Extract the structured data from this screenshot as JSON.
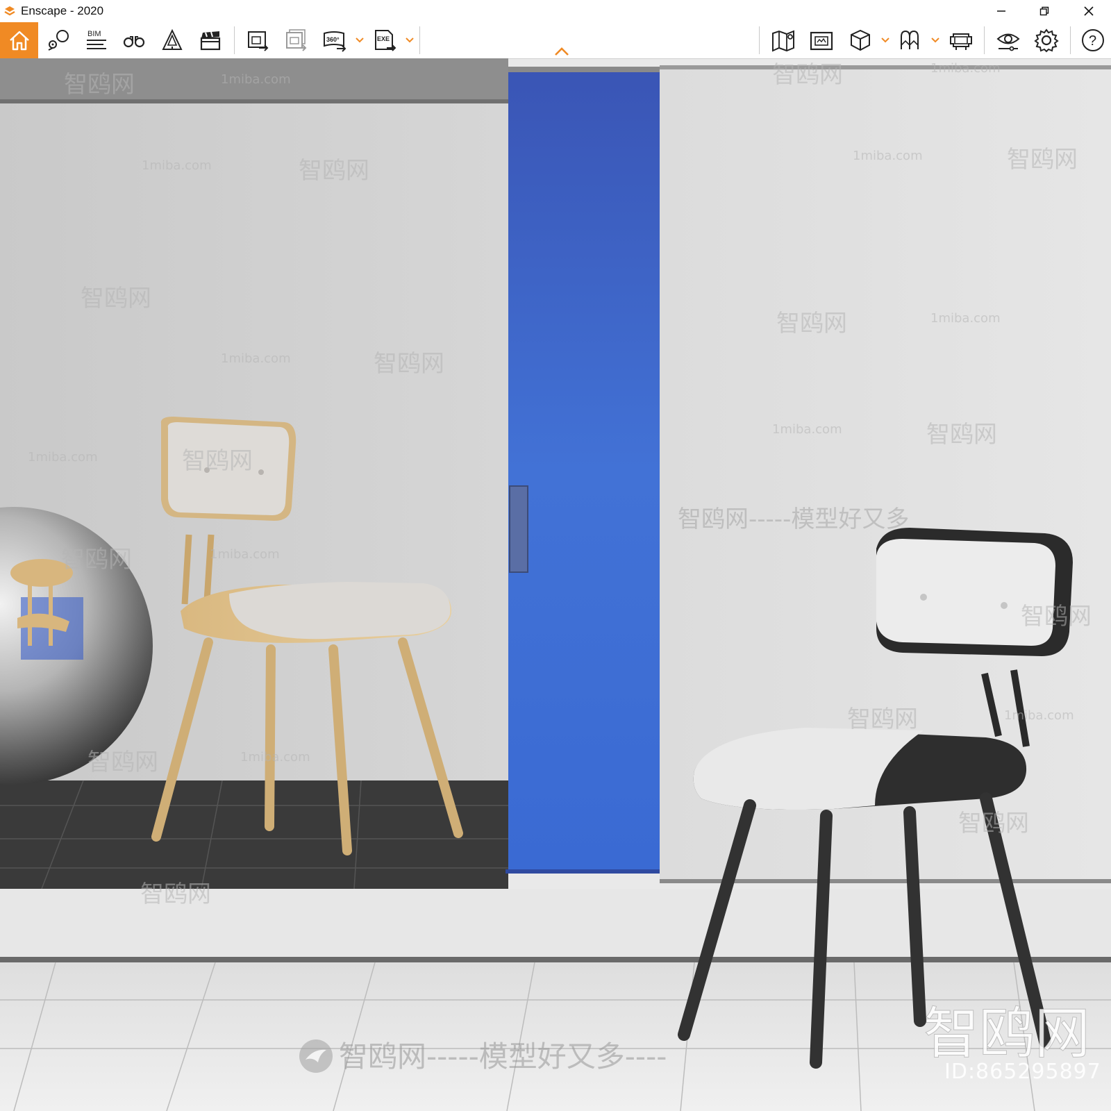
{
  "window": {
    "title": "Enscape - 2020",
    "controls": [
      "minimize",
      "restore",
      "close"
    ]
  },
  "toolbar": {
    "left_buttons": [
      {
        "name": "home",
        "icon": "home-icon"
      },
      {
        "name": "views",
        "icon": "location-pin-icon"
      },
      {
        "name": "bim",
        "icon": "bim-icon",
        "label": "BIM"
      },
      {
        "name": "walk-mode",
        "icon": "binoculars-icon"
      },
      {
        "name": "object-placement",
        "icon": "warning-cone-icon"
      },
      {
        "name": "video-editor",
        "icon": "clapperboard-icon"
      },
      {
        "name": "render-image",
        "icon": "render-image-icon"
      },
      {
        "name": "batch-render",
        "icon": "batch-render-icon"
      },
      {
        "name": "render-panorama",
        "icon": "panorama-360-icon",
        "label": "360°"
      },
      {
        "name": "export-standalone",
        "icon": "exe-export-icon",
        "label": "EXE"
      }
    ],
    "right_buttons": [
      {
        "name": "map",
        "icon": "map-icon"
      },
      {
        "name": "capture",
        "icon": "capture-icon"
      },
      {
        "name": "asset-library",
        "icon": "cube-icon"
      },
      {
        "name": "material-editor",
        "icon": "material-icon"
      },
      {
        "name": "vr-headset",
        "icon": "vr-headset-icon"
      },
      {
        "name": "visual-settings",
        "icon": "eye-settings-icon"
      },
      {
        "name": "general-settings",
        "icon": "gear-icon"
      },
      {
        "name": "help",
        "icon": "help-icon",
        "label": "?"
      }
    ],
    "accent": "#f08a24",
    "collapse_icon": "chevron-up-icon"
  },
  "viewport": {
    "scene": "render-viewport",
    "watermarks": {
      "site": "1miba.com",
      "brand": "智鸥网",
      "slogan": "智鸥网-----模型好又多----",
      "slogan_short": "智鸥网-----模型好又多",
      "big_logo": "智鸥网",
      "id": "ID:865295897"
    },
    "colors": {
      "wall": "#d4d4d4",
      "blue_panel": "#3d6bd2",
      "floor_dark": "#3a3a3a",
      "floor_light": "#ececec"
    }
  }
}
